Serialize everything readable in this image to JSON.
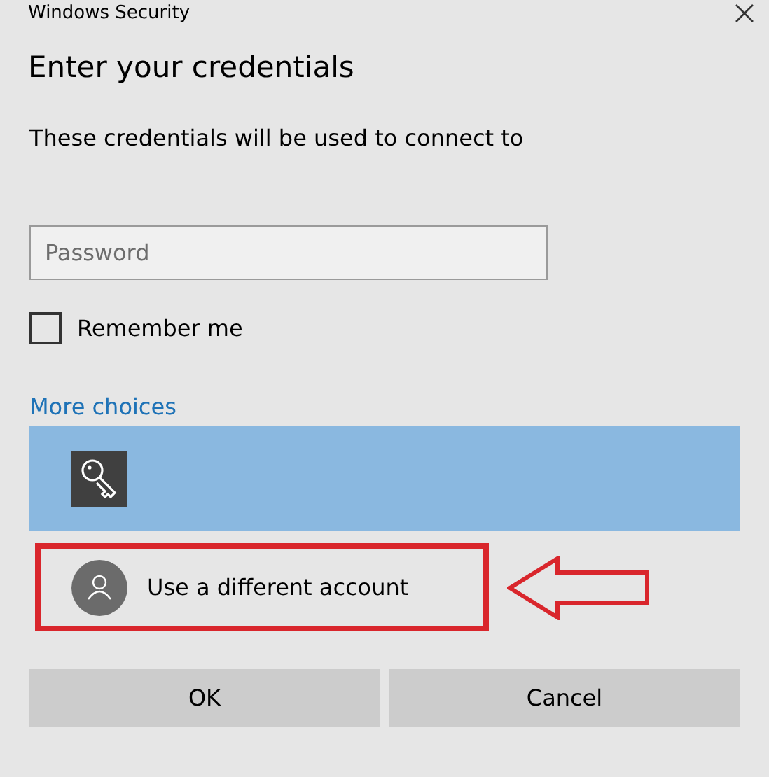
{
  "window": {
    "title": "Windows Security"
  },
  "heading": "Enter your credentials",
  "message": "These credentials will be used to connect to",
  "password": {
    "placeholder": "Password"
  },
  "remember_me": {
    "label": "Remember me",
    "checked": false
  },
  "more_choices": "More choices",
  "choices": [
    {
      "kind": "key",
      "selected": true,
      "highlighted": false
    },
    {
      "kind": "account",
      "label": "Use a different account",
      "selected": false,
      "highlighted": true
    }
  ],
  "buttons": [
    "OK",
    "Cancel"
  ]
}
